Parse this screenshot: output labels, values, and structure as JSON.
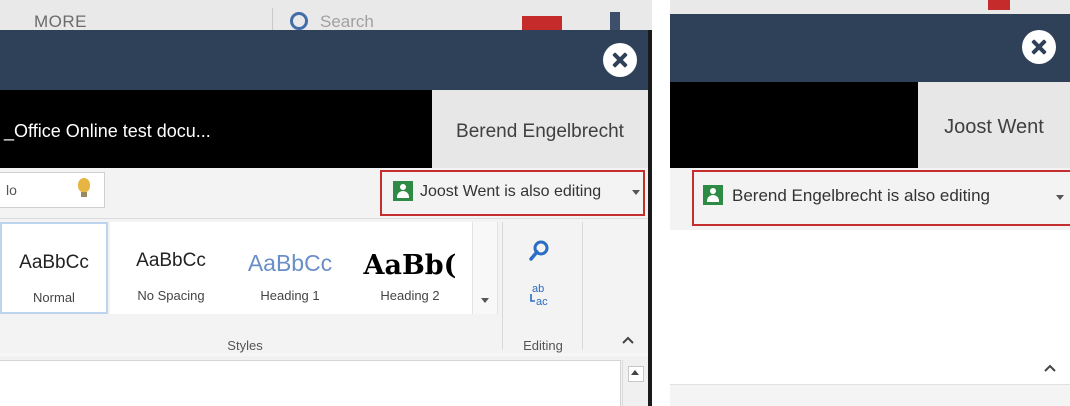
{
  "left": {
    "background": {
      "more_label": "MORE",
      "search_placeholder": "Search"
    },
    "document_title": "_Office Online test docu...",
    "current_user": "Berend Engelbrecht",
    "tell_me_fragment": "lo",
    "coauthor_status": "Joost Went is also editing",
    "styles": [
      {
        "sample": "AaBbCc",
        "name": "Normal"
      },
      {
        "sample": "AaBbCc",
        "name": "No Spacing"
      },
      {
        "sample": "AaBbCc",
        "name": "Heading 1"
      },
      {
        "sample": "AaBb(",
        "name": "Heading 2"
      }
    ],
    "styles_group_label": "Styles",
    "editing_group_label": "Editing"
  },
  "right": {
    "current_user": "Joost Went",
    "coauthor_status": "Berend Engelbrecht is also editing"
  },
  "colors": {
    "titlebar": "#2f4059",
    "document_bar": "#000000",
    "highlight_border": "#c62d2d",
    "presence_icon": "#2e8b45",
    "heading1": "#6a8fc8"
  },
  "icons": [
    "close-icon",
    "lightbulb-icon",
    "user-presence-icon",
    "find-icon",
    "replace-icon",
    "chevron-up-icon",
    "dropdown-caret-icon"
  ]
}
